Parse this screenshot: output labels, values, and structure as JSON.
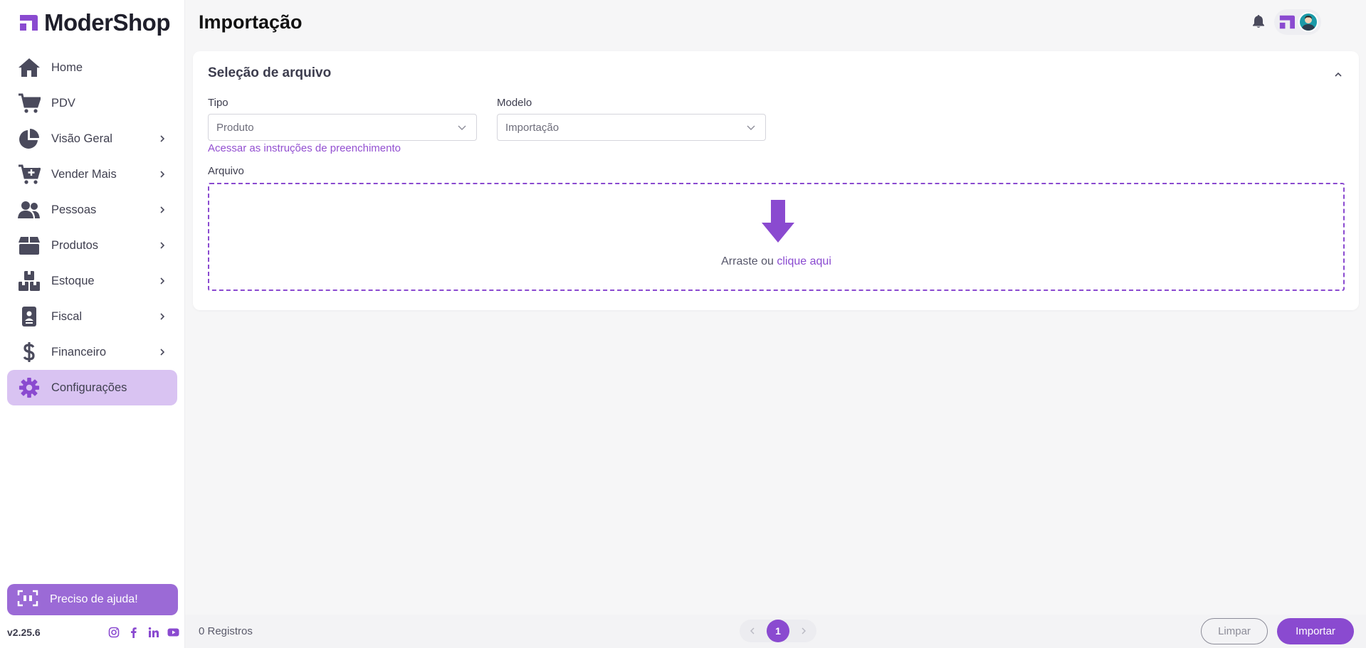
{
  "app": {
    "name": "ModerShop",
    "accent": "#8a4ad0"
  },
  "sidebar": {
    "items": [
      {
        "label": "Home",
        "icon": "home-icon"
      },
      {
        "label": "PDV",
        "icon": "cart-icon"
      },
      {
        "label": "Visão Geral",
        "icon": "pie-chart-icon"
      },
      {
        "label": "Vender Mais",
        "icon": "cart-plus-icon"
      },
      {
        "label": "Pessoas",
        "icon": "people-icon"
      },
      {
        "label": "Produtos",
        "icon": "box-icon"
      },
      {
        "label": "Estoque",
        "icon": "boxes-icon"
      },
      {
        "label": "Fiscal",
        "icon": "id-badge-icon"
      },
      {
        "label": "Financeiro",
        "icon": "dollar-icon"
      },
      {
        "label": "Configurações",
        "icon": "gear-icon"
      }
    ],
    "active_item": "Configurações",
    "help_label": "Preciso de ajuda!",
    "version": "v2.25.6"
  },
  "header": {
    "title": "Importação"
  },
  "card": {
    "title": "Seleção de arquivo",
    "tipo_label": "Tipo",
    "tipo_value": "Produto",
    "modelo_label": "Modelo",
    "modelo_value": "Importação",
    "instructions_link": "Acessar as instruções de preenchimento",
    "arquivo_label": "Arquivo",
    "drop_text": "Arraste ou",
    "drop_link": "clique aqui"
  },
  "footer": {
    "records": "0 Registros",
    "current_page": "1",
    "clear_label": "Limpar",
    "import_label": "Importar"
  }
}
